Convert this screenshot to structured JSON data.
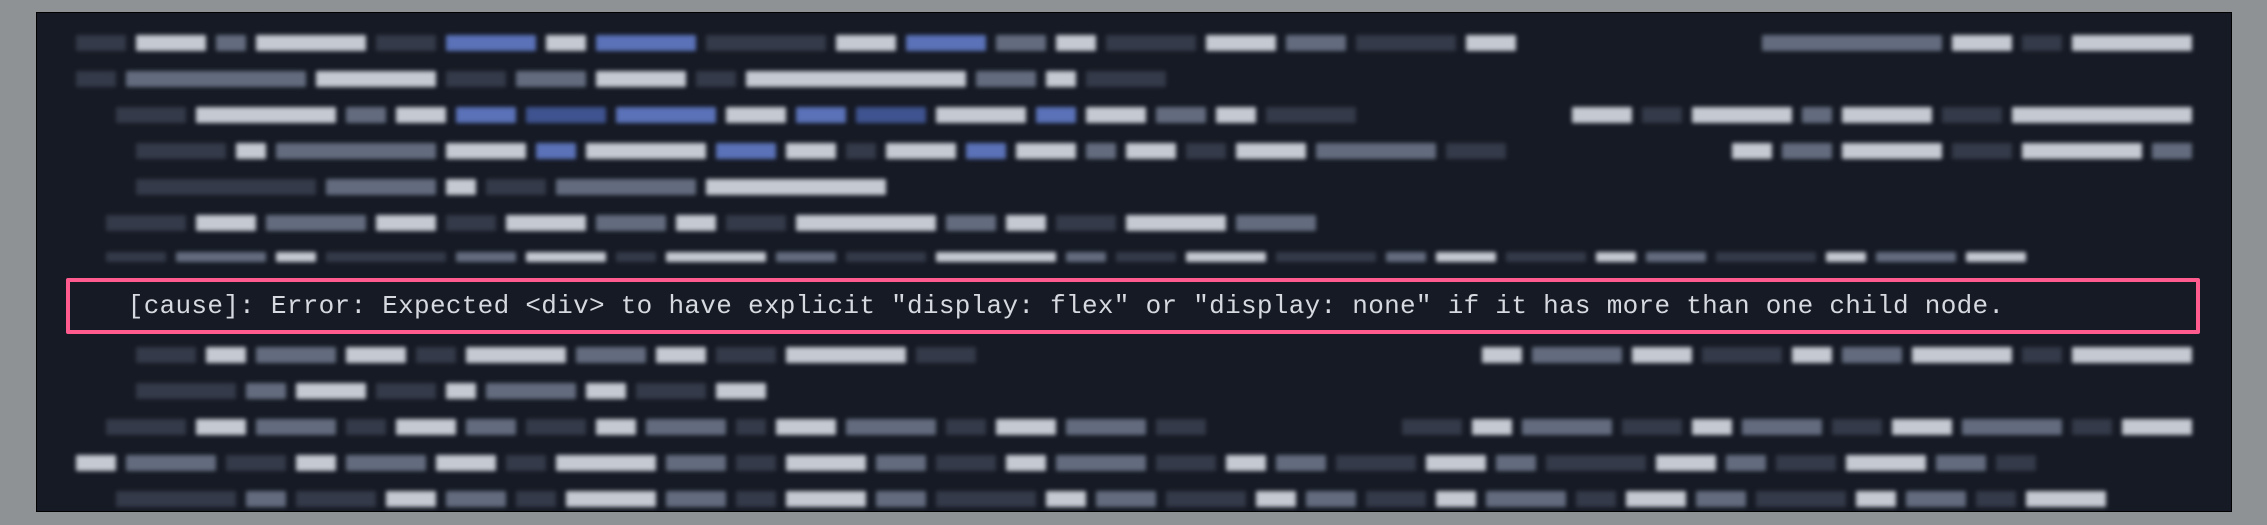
{
  "error": {
    "line": "  [cause]: Error: Expected <div> to have explicit \"display: flex\" or \"display: none\" if it has more than one child node."
  }
}
